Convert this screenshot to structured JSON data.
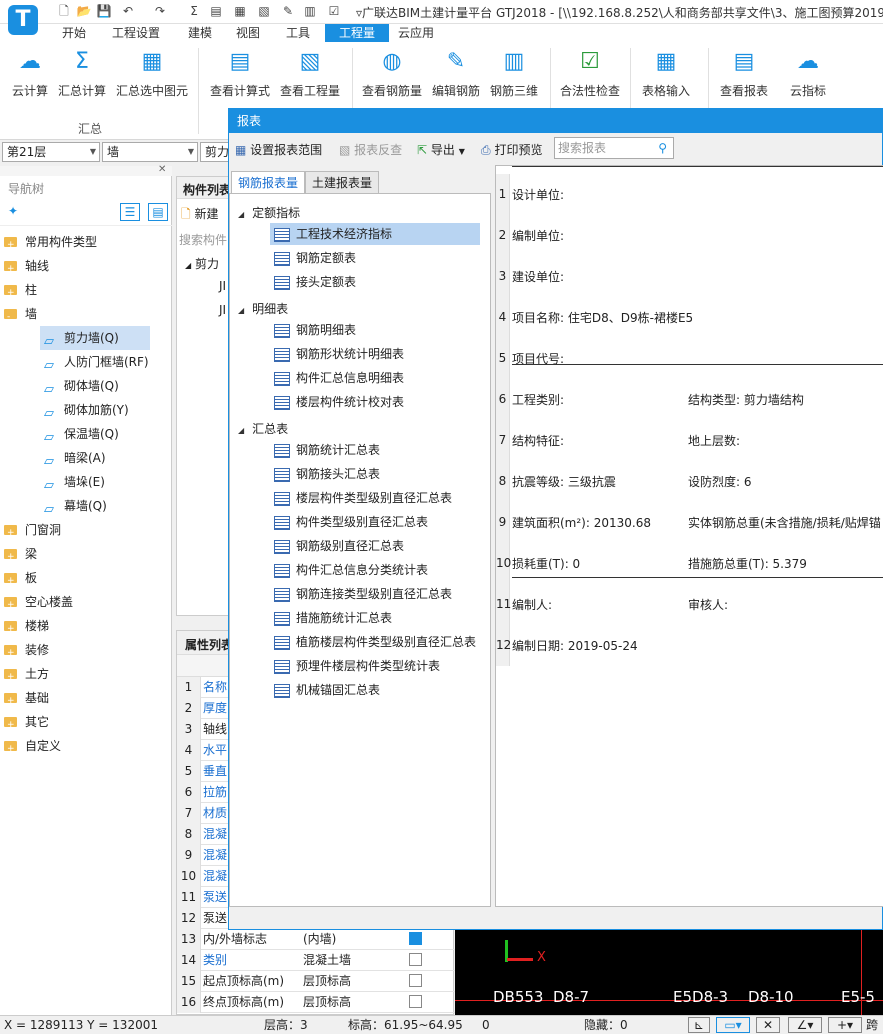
{
  "titlebar": {
    "title": "▿广联达BIM土建计量平台 GTJ2018 - [\\\\192.168.8.252\\人和商务部共享文件\\3、施工图预算2019\\2",
    "logo": "T"
  },
  "menus": [
    "开始",
    "工程设置",
    "建模",
    "视图",
    "工具",
    "工程量",
    "云应用"
  ],
  "ribbon": {
    "buttons": [
      {
        "label": "云计算",
        "icon": "cloud-sigma-icon"
      },
      {
        "label": "汇总计算",
        "icon": "sigma-icon"
      },
      {
        "label": "汇总选中图元",
        "icon": "grid-select-icon"
      },
      {
        "label": "查看计算式",
        "icon": "formula-search-icon"
      },
      {
        "label": "查看工程量",
        "icon": "quantity-search-icon"
      },
      {
        "label": "查看钢筋量",
        "icon": "rebar-glasses-icon"
      },
      {
        "label": "编辑钢筋",
        "icon": "edit-rebar-icon"
      },
      {
        "label": "钢筋三维",
        "icon": "rebar-3d-icon"
      },
      {
        "label": "合法性检查",
        "icon": "check-icon"
      },
      {
        "label": "表格输入",
        "icon": "table-input-icon"
      },
      {
        "label": "查看报表",
        "icon": "report-icon"
      },
      {
        "label": "云指标",
        "icon": "cloud-index-icon"
      }
    ],
    "group_label": "汇总"
  },
  "floor_select": "第21层",
  "type_select": "墙",
  "third_select": "剪力",
  "navtree": {
    "title": "导航树",
    "items": [
      {
        "label": "常用构件类型",
        "level": 0,
        "open": false
      },
      {
        "label": "轴线",
        "level": 0,
        "open": false
      },
      {
        "label": "柱",
        "level": 0,
        "open": false
      },
      {
        "label": "墙",
        "level": 0,
        "open": true
      },
      {
        "label": "剪力墙(Q)",
        "level": 1,
        "selected": true
      },
      {
        "label": "人防门框墙(RF)",
        "level": 1
      },
      {
        "label": "砌体墙(Q)",
        "level": 1
      },
      {
        "label": "砌体加筋(Y)",
        "level": 1
      },
      {
        "label": "保温墙(Q)",
        "level": 1
      },
      {
        "label": "暗梁(A)",
        "level": 1
      },
      {
        "label": "墙垛(E)",
        "level": 1
      },
      {
        "label": "幕墙(Q)",
        "level": 1
      },
      {
        "label": "门窗洞",
        "level": 0
      },
      {
        "label": "梁",
        "level": 0
      },
      {
        "label": "板",
        "level": 0
      },
      {
        "label": "空心楼盖",
        "level": 0
      },
      {
        "label": "楼梯",
        "level": 0
      },
      {
        "label": "装修",
        "level": 0
      },
      {
        "label": "土方",
        "level": 0
      },
      {
        "label": "基础",
        "level": 0
      },
      {
        "label": "其它",
        "level": 0
      },
      {
        "label": "自定义",
        "level": 0
      }
    ]
  },
  "complist": {
    "title": "构件列表",
    "new_label": "新建",
    "search_placeholder": "搜索构件",
    "tree_root": "剪力",
    "items": [
      "JI",
      "JI"
    ]
  },
  "props": {
    "title": "属性列表",
    "header": "",
    "rows": [
      {
        "no": "1",
        "name": "名称",
        "value": "",
        "blue": true
      },
      {
        "no": "2",
        "name": "厚度",
        "value": "",
        "blue": true
      },
      {
        "no": "3",
        "name": "轴线",
        "value": "",
        "blue": false
      },
      {
        "no": "4",
        "name": "水平",
        "value": "",
        "blue": true
      },
      {
        "no": "5",
        "name": "垂直",
        "value": "",
        "blue": true
      },
      {
        "no": "6",
        "name": "拉筋",
        "value": "",
        "blue": true
      },
      {
        "no": "7",
        "name": "材质",
        "value": "",
        "blue": true
      },
      {
        "no": "8",
        "name": "混凝",
        "value": "",
        "blue": true
      },
      {
        "no": "9",
        "name": "混凝",
        "value": "",
        "blue": true
      },
      {
        "no": "10",
        "name": "混凝",
        "value": "",
        "blue": true
      },
      {
        "no": "11",
        "name": "泵送",
        "value": "",
        "blue": true
      },
      {
        "no": "12",
        "name": "泵送",
        "value": "",
        "blue": false
      },
      {
        "no": "13",
        "name": "内/外墙标志",
        "value": "(内墙)",
        "blue": false,
        "check": true
      },
      {
        "no": "14",
        "name": "类别",
        "value": "混凝土墙",
        "blue": true,
        "check": false
      },
      {
        "no": "15",
        "name": "起点顶标高(m)",
        "value": "层顶标高",
        "blue": false,
        "check": false
      },
      {
        "no": "16",
        "name": "终点顶标高(m)",
        "value": "层顶标高",
        "blue": false,
        "check": false
      }
    ]
  },
  "dialog": {
    "title": "报表",
    "toolbar": {
      "set_range": "设置报表范围",
      "reverse": "报表反查",
      "export": "导出",
      "print_preview": "打印预览",
      "search_placeholder": "搜索报表"
    },
    "tabs": [
      "钢筋报表量",
      "土建报表量"
    ],
    "sections": [
      {
        "title": "定额指标",
        "items": [
          "工程技术经济指标",
          "钢筋定额表",
          "接头定额表"
        ]
      },
      {
        "title": "明细表",
        "items": [
          "钢筋明细表",
          "钢筋形状统计明细表",
          "构件汇总信息明细表",
          "楼层构件统计校对表"
        ]
      },
      {
        "title": "汇总表",
        "items": [
          "钢筋统计汇总表",
          "钢筋接头汇总表",
          "楼层构件类型级别直径汇总表",
          "构件类型级别直径汇总表",
          "钢筋级别直径汇总表",
          "构件汇总信息分类统计表",
          "钢筋连接类型级别直径汇总表",
          "措施筋统计汇总表",
          "植筋楼层构件类型级别直径汇总表",
          "预埋件楼层构件类型统计表",
          "机械锚固汇总表"
        ]
      }
    ],
    "selected_item": "工程技术经济指标",
    "preview_rows": [
      {
        "n": "1",
        "a": "设计单位:",
        "b": ""
      },
      {
        "n": "2",
        "a": "编制单位:",
        "b": ""
      },
      {
        "n": "3",
        "a": "建设单位:",
        "b": ""
      },
      {
        "n": "4",
        "a": "项目名称: 住宅D8、D9栋-裙楼E5",
        "b": ""
      },
      {
        "n": "5",
        "a": "项目代号:",
        "b": ""
      },
      {
        "n": "6",
        "a": "工程类别:",
        "b": "结构类型: 剪力墙结构"
      },
      {
        "n": "7",
        "a": "结构特征:",
        "b": "地上层数:"
      },
      {
        "n": "8",
        "a": "抗震等级: 三级抗震",
        "b": "设防烈度: 6"
      },
      {
        "n": "9",
        "a": "建筑面积(m²): 20130.68",
        "b": "实体钢筋总重(未含措施/损耗/贴焊锚"
      },
      {
        "n": "10",
        "a": "损耗重(T): 0",
        "b": "措施筋总重(T): 5.379"
      },
      {
        "n": "11",
        "a": "编制人:",
        "b": "审核人:"
      },
      {
        "n": "12",
        "a": "编制日期: 2019-05-24",
        "b": ""
      }
    ]
  },
  "canvas": {
    "labels": [
      "DB553",
      "D8-7",
      "E5D8-3",
      "D8-10",
      "E5-5"
    ],
    "axis_x": "X"
  },
  "status": {
    "coords": "X = 1289113 Y = 132001",
    "floor_height": "层高：3",
    "elevation": "标高：61.95~64.95",
    "zero": "0",
    "hidden": "隐藏：0",
    "right": "跨"
  }
}
